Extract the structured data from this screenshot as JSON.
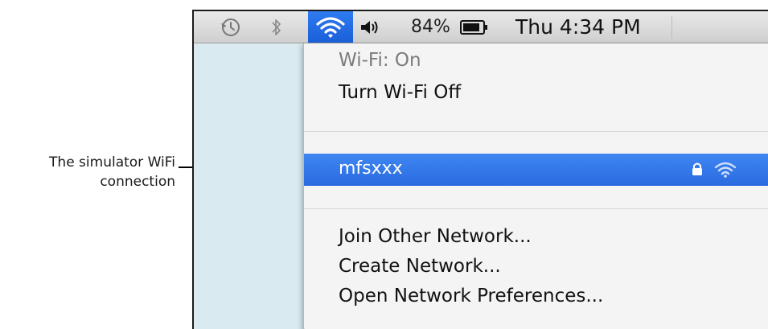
{
  "callout": {
    "line1": "The simulator WiFi",
    "line2": "connection"
  },
  "menubar": {
    "icons": [
      "time-machine-icon",
      "bluetooth-icon",
      "wifi-icon",
      "volume-icon",
      "battery-icon"
    ],
    "battery_percent": "84%",
    "clock": "Thu 4:34 PM"
  },
  "wifi_menu": {
    "status": "Wi-Fi: On",
    "toggle": "Turn Wi-Fi Off",
    "network": {
      "name": "mfsxxx",
      "secured": true,
      "icons": [
        "lock-icon",
        "wifi-signal-icon"
      ]
    },
    "join_other": "Join Other Network...",
    "create": "Create Network...",
    "preferences": "Open Network Preferences..."
  },
  "colors": {
    "highlight": "#2f7bf0",
    "menu_background": "#f4f4f4",
    "desktop": "#d9eaf0"
  }
}
